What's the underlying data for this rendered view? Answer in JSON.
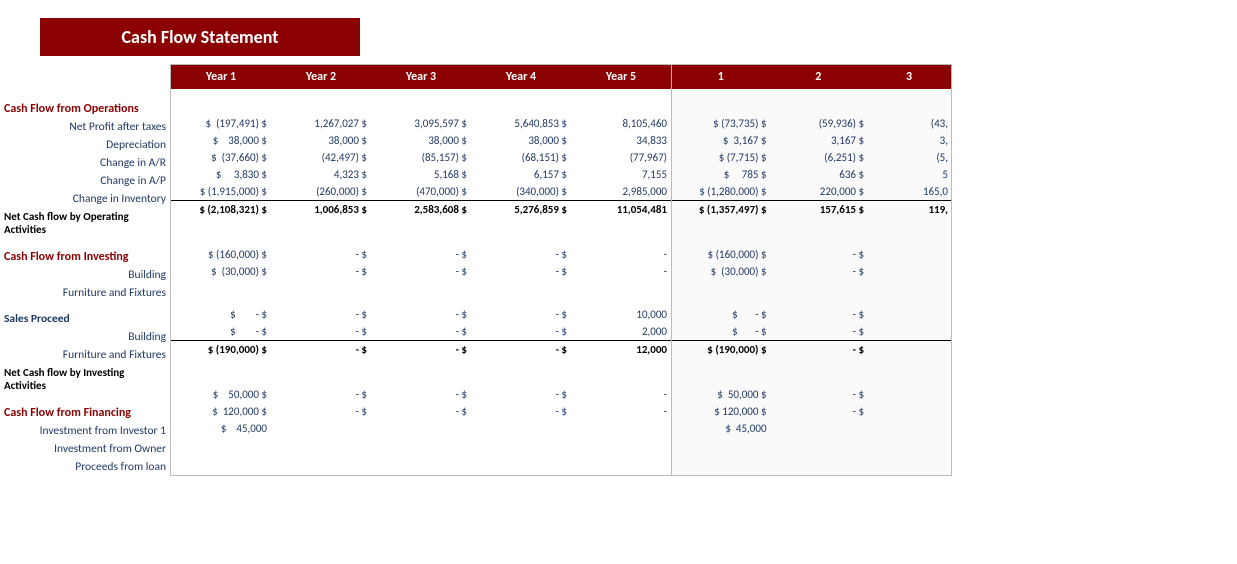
{
  "title": "Cash Flow Statement",
  "years_header": [
    "Year 1",
    "Year 2",
    "Year 3",
    "Year 4",
    "Year 5"
  ],
  "quarters_header": [
    "1",
    "2",
    "3"
  ],
  "sections": {
    "operations": {
      "header": "Cash Flow from Operations",
      "rows": [
        {
          "label": "Net Profit after taxes",
          "y1": "(197,491)",
          "y2": "1,267,027",
          "y3": "3,095,597",
          "y4": "5,640,853",
          "y5": "8,105,460",
          "q1": "(73,735)",
          "q2": "(59,936)",
          "q3": "(43,"
        },
        {
          "label": "Depreciation",
          "y1": "38,000",
          "y2": "38,000",
          "y3": "38,000",
          "y4": "38,000",
          "y5": "34,833",
          "q1": "3,167",
          "q2": "3,167",
          "q3": "3,"
        },
        {
          "label": "Change in A/R",
          "y1": "(37,660)",
          "y2": "(42,497)",
          "y3": "(85,157)",
          "y4": "(68,151)",
          "y5": "(77,967)",
          "q1": "(7,715)",
          "q2": "(6,251)",
          "q3": "(5,"
        },
        {
          "label": "Change in A/P",
          "y1": "3,830",
          "y2": "4,323",
          "y3": "5,168",
          "y4": "6,157",
          "y5": "7,155",
          "q1": "785",
          "q2": "636",
          "q3": "5"
        },
        {
          "label": "Change in Inventory",
          "y1": "(1,915,000)",
          "y2": "(260,000)",
          "y3": "(470,000)",
          "y4": "(340,000)",
          "y5": "2,985,000",
          "q1": "(1,280,000)",
          "q2": "220,000",
          "q3": "165,0"
        }
      ],
      "total_label": "Net Cash flow by Operating Activities",
      "totals": {
        "y1": "(2,108,321)",
        "y2": "1,006,853",
        "y3": "2,583,608",
        "y4": "5,276,859",
        "y5": "11,054,481",
        "q1": "(1,357,497)",
        "q2": "157,615",
        "q3": "119,"
      }
    },
    "investing": {
      "header": "Cash Flow from Investing",
      "rows": [
        {
          "label": "Building",
          "y1": "(160,000)",
          "y2": "-",
          "y3": "-",
          "y4": "-",
          "y5": "-",
          "q1": "(160,000)",
          "q2": "-",
          "q3": ""
        },
        {
          "label": "Furniture and Fixtures",
          "y1": "(30,000)",
          "y2": "-",
          "y3": "-",
          "y4": "-",
          "y5": "-",
          "q1": "(30,000)",
          "q2": "-",
          "q3": ""
        }
      ],
      "sub_header": "Sales Proceed",
      "sub_rows": [
        {
          "label": "Building",
          "y1": "-",
          "y2": "-",
          "y3": "-",
          "y4": "-",
          "y5": "10,000",
          "q1": "-",
          "q2": "-",
          "q3": ""
        },
        {
          "label": "Furniture and Fixtures",
          "y1": "-",
          "y2": "-",
          "y3": "-",
          "y4": "-",
          "y5": "2,000",
          "q1": "-",
          "q2": "-",
          "q3": ""
        }
      ],
      "total_label": "Net Cash flow by Investing Activities",
      "totals": {
        "y1": "(190,000)",
        "y2": "-",
        "y3": "-",
        "y4": "-",
        "y5": "12,000",
        "q1": "(190,000)",
        "q2": "-",
        "q3": ""
      }
    },
    "financing": {
      "header": "Cash Flow from Financing",
      "rows": [
        {
          "label": "Investment from Investor 1",
          "y1": "50,000",
          "y2": "-",
          "y3": "-",
          "y4": "-",
          "y5": "-",
          "q1": "50,000",
          "q2": "-",
          "q3": ""
        },
        {
          "label": "Investment from Owner",
          "y1": "120,000",
          "y2": "-",
          "y3": "-",
          "y4": "-",
          "y5": "-",
          "q1": "120,000",
          "q2": "-",
          "q3": ""
        },
        {
          "label": "Proceeds from loan",
          "y1": "45,000",
          "y2": "",
          "y3": "",
          "y4": "",
          "y5": "",
          "q1": "45,000",
          "q2": "",
          "q3": ""
        }
      ]
    }
  }
}
